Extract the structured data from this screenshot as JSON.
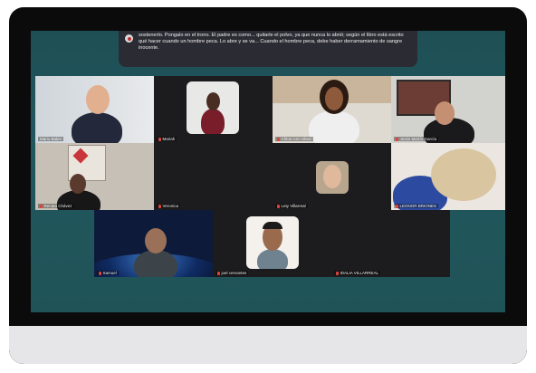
{
  "caption": {
    "text": "sostenerlo. Pongalo en el trono. El padre es como... quitarle el polvo, ya que nunca lo abrió; según el libro está escrito qué hacer cuando un hombre peca. Lo abre y se va... Cuando el hombre peca, debe haber derramamiento de sangre inocente."
  },
  "participants": [
    {
      "name": "Mario Baker"
    },
    {
      "name": "Mariah"
    },
    {
      "name": "Chloe-Ann Shea"
    },
    {
      "name": "Jesús Martín García"
    },
    {
      "name": "Renata Chávez"
    },
    {
      "name": "Veronica"
    },
    {
      "name": "Lety Villarreal"
    },
    {
      "name": "LEONOR BRIONES"
    },
    {
      "name": "Samuel"
    },
    {
      "name": "joel cervantes"
    },
    {
      "name": "IDALIA VILLARREAL"
    }
  ],
  "colors": {
    "background": "#1f5358",
    "tile": "#1c1c1e",
    "active_border": "#8fd06d",
    "mic_muted": "#e0433b"
  }
}
